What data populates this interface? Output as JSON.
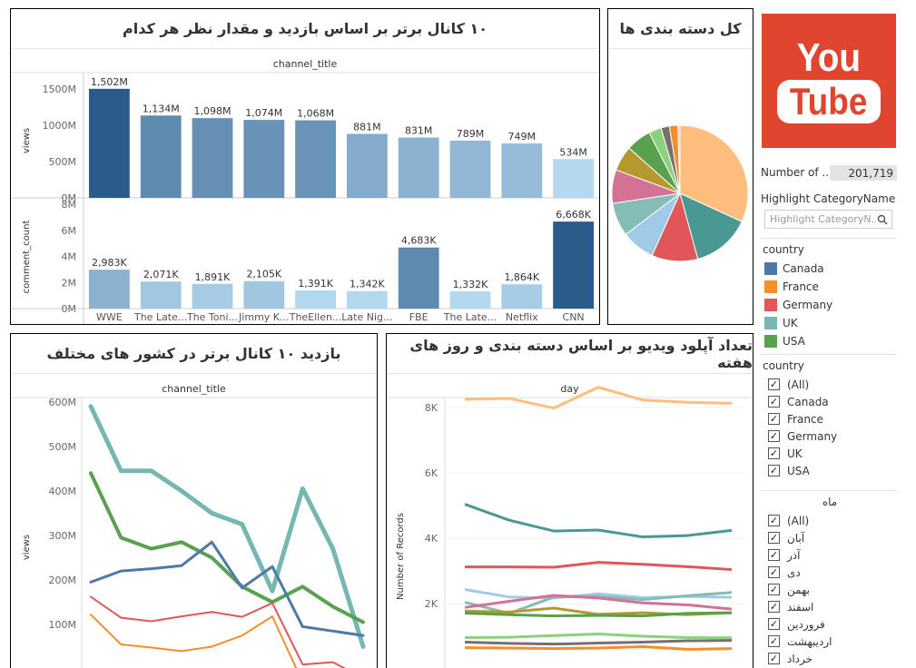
{
  "panels": {
    "top_channels": {
      "title": "۱۰ کانال برتر بر اساس بازدید و مقدار نظر هر کدام",
      "column_header": "channel_title",
      "views_axis_label": "views",
      "comments_axis_label": "comment_count"
    },
    "categories": {
      "title": "کل دسته بندی ها"
    },
    "country_views": {
      "title": "بازدید ۱۰ کانال برتر در کشور های مختلف",
      "column_header": "channel_title",
      "axis_label": "views"
    },
    "uploads": {
      "title": "تعداد آپلود ویدیو بر اساس دسته بندی و روز های هفته",
      "column_header": "day",
      "axis_label": "Number of Records"
    }
  },
  "sidebar": {
    "logo_top": "You",
    "logo_bottom": "Tube",
    "records_label": "Number of ..",
    "records_value": "201,719",
    "highlight_label": "Highlight CategoryName",
    "highlight_placeholder": "Highlight CategoryN...",
    "legend_title": "country",
    "legend": [
      {
        "name": "Canada",
        "color": "#4e79a7"
      },
      {
        "name": "France",
        "color": "#f28e2b"
      },
      {
        "name": "Germany",
        "color": "#e15759"
      },
      {
        "name": "UK",
        "color": "#76b7b2"
      },
      {
        "name": "USA",
        "color": "#59a14f"
      }
    ],
    "country_filter_title": "country",
    "country_filter": [
      "(All)",
      "Canada",
      "France",
      "Germany",
      "UK",
      "USA"
    ],
    "month_filter_title": "ماه",
    "month_filter": [
      "(All)",
      "آبان",
      "آذر",
      "دی",
      "بهمن",
      "اسفند",
      "فروردین",
      "اردیبهشت",
      "خرداد"
    ]
  },
  "chart_data": [
    {
      "type": "bar",
      "title": "۱۰ کانال برتر بر اساس بازدید و مقدار نظر هر کدام",
      "xlabel": "channel_title",
      "categories": [
        "WWE",
        "The Late...",
        "The Toni...",
        "Jimmy K...",
        "TheEllen...",
        "Late Nig...",
        "FBE",
        "The Late...",
        "Netflix",
        "CNN"
      ],
      "series": [
        {
          "name": "views",
          "values": [
            1502,
            1134,
            1098,
            1074,
            1068,
            881,
            831,
            789,
            749,
            534
          ],
          "labels": [
            "1,502M",
            "1,134M",
            "1,098M",
            "1,074M",
            "1,068M",
            "881M",
            "831M",
            "789M",
            "749M",
            "534M"
          ],
          "ylim": [
            0,
            1600
          ],
          "ticks": [
            "0M",
            "500M",
            "1000M",
            "1500M"
          ]
        },
        {
          "name": "comment_count",
          "values": [
            2983,
            2071,
            1891,
            2105,
            1391,
            1342,
            4683,
            1332,
            1864,
            6668
          ],
          "labels": [
            "2,983K",
            "2,071K",
            "1,891K",
            "2,105K",
            "1,391K",
            "1,342K",
            "4,683K",
            "1,332K",
            "1,864K",
            "6,668K"
          ],
          "ylim": [
            0,
            8000
          ],
          "ticks": [
            "0M",
            "2M",
            "4M",
            "6M",
            "8M"
          ]
        }
      ]
    },
    {
      "type": "pie",
      "title": "کل دسته بندی ها",
      "values": [
        32,
        14,
        11,
        8,
        8,
        8,
        6,
        6,
        3,
        2,
        2,
        0.5
      ],
      "colors": [
        "#ffbe7d",
        "#499894",
        "#e15759",
        "#a0cbe8",
        "#86bcb6",
        "#d37295",
        "#b6992d",
        "#59a14f",
        "#8cd17d",
        "#79706e",
        "#f28e2b",
        "#fabfd2"
      ]
    },
    {
      "type": "line",
      "title": "بازدید ۱۰ کانال برتر در کشور های مختلف",
      "xlabel": "channel_title",
      "ylabel": "views",
      "ylim": [
        0,
        620
      ],
      "ticks": [
        "100M",
        "200M",
        "300M",
        "400M",
        "500M",
        "600M"
      ],
      "series": [
        {
          "name": "UK",
          "color": "#76b7b2",
          "width": 5,
          "values": [
            590,
            445,
            445,
            400,
            350,
            325,
            175,
            405,
            270,
            50
          ]
        },
        {
          "name": "USA",
          "color": "#59a14f",
          "width": 4,
          "values": [
            440,
            295,
            270,
            285,
            250,
            185,
            150,
            185,
            140,
            105
          ]
        },
        {
          "name": "Canada",
          "color": "#4e79a7",
          "width": 3,
          "values": [
            195,
            220,
            225,
            232,
            285,
            182,
            230,
            95,
            85,
            75
          ]
        },
        {
          "name": "Germany",
          "color": "#e15759",
          "width": 2,
          "values": [
            162,
            115,
            107,
            118,
            128,
            117,
            148,
            10,
            15,
            -20
          ]
        },
        {
          "name": "France",
          "color": "#f28e2b",
          "width": 2,
          "values": [
            122,
            55,
            48,
            40,
            50,
            75,
            118,
            -30,
            -40,
            -50
          ]
        }
      ]
    },
    {
      "type": "line",
      "title": "تعداد آپلود ویدیو بر اساس دسته بندی و روز های هفته",
      "xlabel": "day",
      "ylabel": "Number of Records",
      "ylim": [
        0,
        9000
      ],
      "ticks": [
        "2K",
        "4K",
        "6K",
        "8K"
      ],
      "series": [
        {
          "color": "#ffbe7d",
          "values": [
            8250,
            8280,
            7980,
            8620,
            8230,
            8160,
            8130
          ]
        },
        {
          "color": "#499894",
          "values": [
            5040,
            4550,
            4220,
            4250,
            4040,
            4080,
            4240
          ]
        },
        {
          "color": "#e15759",
          "values": [
            3120,
            3120,
            3110,
            3260,
            3200,
            3130,
            3040
          ]
        },
        {
          "color": "#a0cbe8",
          "values": [
            2430,
            2200,
            2170,
            2300,
            2180,
            2220,
            2190
          ]
        },
        {
          "color": "#86bcb6",
          "values": [
            2040,
            1700,
            2200,
            2220,
            2120,
            2240,
            2340
          ]
        },
        {
          "color": "#d37295",
          "values": [
            1880,
            2070,
            2250,
            2170,
            2020,
            1960,
            1830
          ]
        },
        {
          "color": "#b6992d",
          "values": [
            1770,
            1740,
            1860,
            1670,
            1720,
            1660,
            1720
          ]
        },
        {
          "color": "#59a14f",
          "values": [
            1710,
            1660,
            1620,
            1640,
            1620,
            1700,
            1720
          ]
        },
        {
          "color": "#8cd17d",
          "values": [
            960,
            970,
            1020,
            1070,
            1000,
            960,
            950
          ]
        },
        {
          "color": "#79706e",
          "values": [
            820,
            780,
            760,
            790,
            820,
            860,
            870
          ]
        },
        {
          "color": "#f28e2b",
          "values": [
            650,
            640,
            620,
            640,
            680,
            600,
            620
          ]
        }
      ]
    }
  ]
}
